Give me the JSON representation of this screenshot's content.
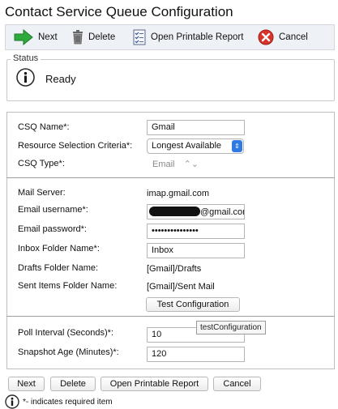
{
  "page": {
    "title": "Contact Service Queue Configuration"
  },
  "toolbar": {
    "next_label": "Next",
    "delete_label": "Delete",
    "print_label": "Open Printable Report",
    "cancel_label": "Cancel",
    "icons": {
      "next": "green-arrow-icon",
      "delete": "trash-icon",
      "print": "checklist-icon",
      "cancel": "red-x-icon"
    }
  },
  "status": {
    "legend": "Status",
    "text": "Ready",
    "icon": "info-icon"
  },
  "form": {
    "csq_name": {
      "label": "CSQ Name*:",
      "value": "Gmail"
    },
    "resource_selection": {
      "label": "Resource Selection Criteria*:",
      "value": "Longest Available"
    },
    "csq_type": {
      "label": "CSQ Type*:",
      "value": "Email"
    },
    "mail_server": {
      "label": "Mail Server:",
      "value": "imap.gmail.com"
    },
    "email_username": {
      "label": "Email username*:",
      "value": "@gmail.com"
    },
    "email_password": {
      "label": "Email password*:",
      "value": "•••••••••••••••"
    },
    "inbox_folder": {
      "label": "Inbox Folder Name*:",
      "value": "Inbox"
    },
    "drafts_folder": {
      "label": "Drafts Folder Name:",
      "value": "[Gmail]/Drafts"
    },
    "sent_folder": {
      "label": "Sent Items Folder Name:",
      "value": "[Gmail]/Sent Mail"
    },
    "test_button": "Test Configuration",
    "tooltip": "testConfiguration",
    "poll_interval": {
      "label": "Poll Interval (Seconds)*:",
      "value": "10"
    },
    "snapshot_age": {
      "label": "Snapshot Age (Minutes)*:",
      "value": "120"
    }
  },
  "bottom_buttons": {
    "next": "Next",
    "delete": "Delete",
    "print": "Open Printable Report",
    "cancel": "Cancel"
  },
  "footer": {
    "note": "*- indicates required item"
  },
  "colors": {
    "toolbar_bg": "#eef1f5",
    "select_arrow": "#2f7ae5",
    "redacted": "#111111"
  }
}
